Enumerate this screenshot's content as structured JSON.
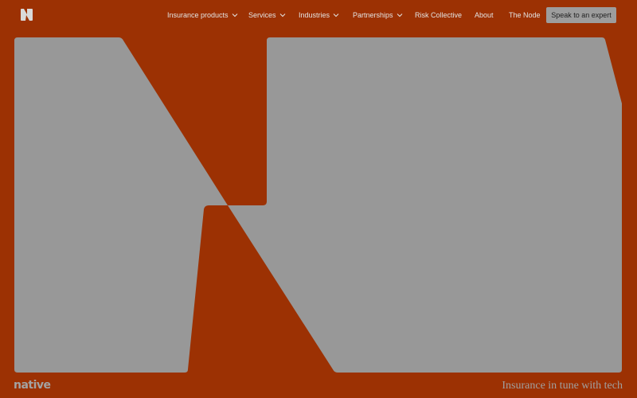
{
  "nav": {
    "items": [
      {
        "label": "Insurance products",
        "has_dropdown": true
      },
      {
        "label": "Services",
        "has_dropdown": true
      },
      {
        "label": "Industries",
        "has_dropdown": true
      },
      {
        "label": "Partnerships",
        "has_dropdown": true
      },
      {
        "label": "Risk Collective",
        "has_dropdown": false
      },
      {
        "label": "About",
        "has_dropdown": false
      },
      {
        "label": "The Node",
        "has_dropdown": false
      }
    ],
    "cta_label": "Speak to an expert"
  },
  "footer": {
    "wordmark": "native",
    "tagline": "Insurance in tune with tech"
  },
  "icons": {
    "logo": "n-logo-icon",
    "dropdown": "chevron-down-icon"
  },
  "colors": {
    "background": "#9c3103",
    "hero_shape": "#989898",
    "nav_text": "#e4e4e4",
    "cta_background": "#9d9d9d",
    "cta_text": "#222222",
    "footer_text": "#a3a3a3"
  }
}
